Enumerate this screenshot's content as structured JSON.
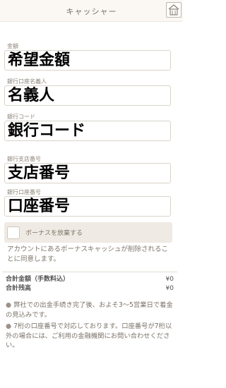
{
  "header": {
    "title": "キャッシャー",
    "home_icon": "home-icon"
  },
  "fields": [
    {
      "label": "金額",
      "value": "希望金額"
    },
    {
      "label": "銀行口座名義人",
      "value": "名義人"
    },
    {
      "label": "銀行コード",
      "value": "銀行コード"
    },
    {
      "label": "銀行支店番号",
      "value": "支店番号"
    },
    {
      "label": "銀行口座番号",
      "value": "口座番号"
    }
  ],
  "bonus": {
    "checkbox_label": "ボーナスを放棄する",
    "note": "アカウントにあるボーナスキャッシュが削除されることに同意します。"
  },
  "totals": {
    "total_amount_label": "合計金額（手数料込）",
    "total_amount_value": "¥0",
    "total_balance_label": "合計残高",
    "total_balance_value": "¥0"
  },
  "notes": [
    "弊社での出金手続き完了後、およそ3～5営業日で着金の見込みです。",
    "7桁の口座番号で対応しております。口座番号が7桁以外の場合には、ご利用の金融機関にお問い合わせください。"
  ],
  "colors": {
    "accent_bg": "#efeae3",
    "header_bg": "#fbf8f4"
  }
}
